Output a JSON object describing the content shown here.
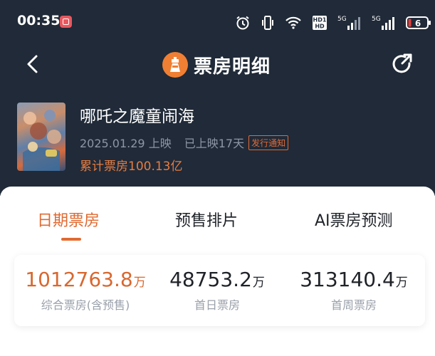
{
  "status_bar": {
    "time": "00:35",
    "hd1": "HD1",
    "hd2": "HD",
    "sig1": "5G",
    "sig2": "5G",
    "battery": "6"
  },
  "nav": {
    "title": "票房明细"
  },
  "movie": {
    "title": "哪吒之魔童闹海",
    "release_date": "2025.01.29 上映",
    "days_released": "已上映17天",
    "badge": "发行通知",
    "total_box_office": "累计票房100.13亿"
  },
  "tabs": [
    {
      "label": "日期票房"
    },
    {
      "label": "预售排片"
    },
    {
      "label": "AI票房预测"
    }
  ],
  "stats": [
    {
      "value": "1012763.8",
      "unit": "万",
      "label": "综合票房(含预售)"
    },
    {
      "value": "48753.2",
      "unit": "万",
      "label": "首日票房"
    },
    {
      "value": "313140.4",
      "unit": "万",
      "label": "首周票房"
    }
  ],
  "colors": {
    "header_bg": "#202a38",
    "accent": "#e06a30",
    "highlight": "#d8682f"
  }
}
